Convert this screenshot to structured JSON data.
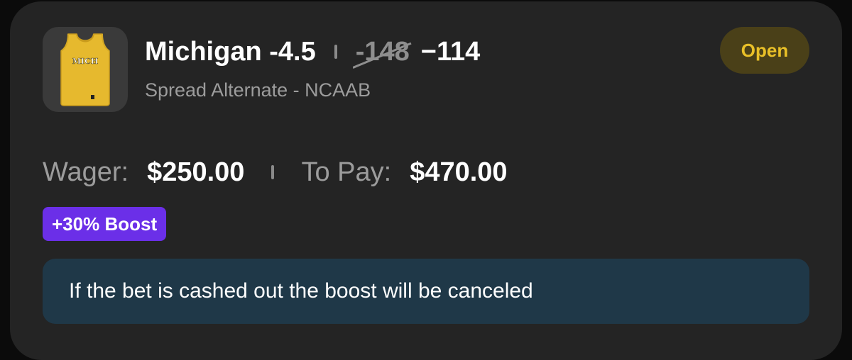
{
  "bet": {
    "selection": "Michigan -4.5",
    "old_odds": "-148",
    "new_odds": "−114",
    "market": "Spread Alternate - NCAAB",
    "status": "Open",
    "team_jersey_text": "MICH"
  },
  "amounts": {
    "wager_label": "Wager:",
    "wager_value": "$250.00",
    "to_pay_label": "To Pay:",
    "to_pay_value": "$470.00"
  },
  "boost": {
    "label": "+30% Boost"
  },
  "notice": {
    "text": "If the bet is cashed out the boost will be canceled"
  },
  "colors": {
    "card_bg": "#242424",
    "status_text": "#e9c028",
    "status_bg": "#4a4018",
    "boost_bg": "#6b2fe8",
    "notice_bg": "#1f3848",
    "jersey": "#e6b92e"
  },
  "icons": {
    "team": "jersey-icon"
  }
}
